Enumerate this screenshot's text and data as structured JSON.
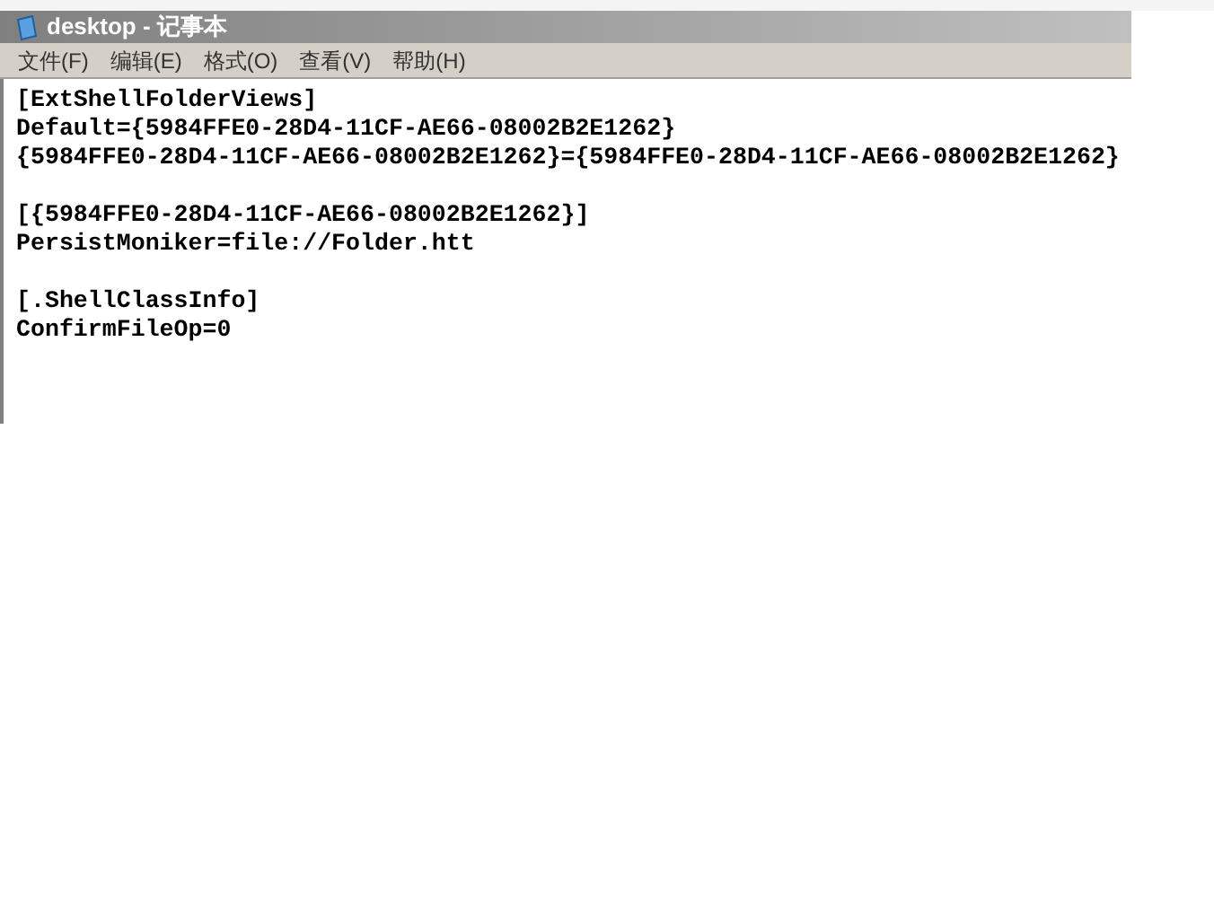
{
  "window": {
    "title": "desktop - 记事本",
    "active": false
  },
  "menu": [
    "文件(F)",
    "编辑(E)",
    "格式(O)",
    "查看(V)",
    "帮助(H)"
  ],
  "editor": {
    "sections": [
      [
        "[ExtShellFolderViews]",
        "Default={5984FFE0-28D4-11CF-AE66-08002B2E1262}",
        "{5984FFE0-28D4-11CF-AE66-08002B2E1262}={5984FFE0-28D4-11CF-AE66-08002B2E1262}"
      ],
      [
        "[{5984FFE0-28D4-11CF-AE66-08002B2E1262}]",
        "PersistMoniker=file://Folder.htt"
      ],
      [
        "[.ShellClassInfo]",
        "ConfirmFileOp=0"
      ]
    ]
  }
}
